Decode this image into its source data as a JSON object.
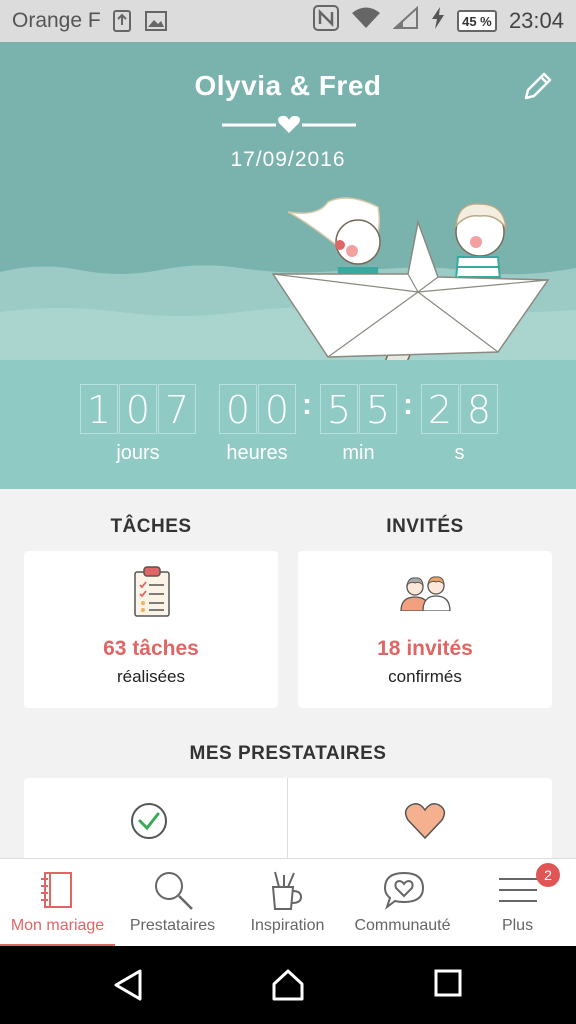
{
  "status_bar": {
    "carrier": "Orange F",
    "battery": "45 %",
    "time": "23:04"
  },
  "header": {
    "couple": "Olyvia & Fred",
    "date": "17/09/2016",
    "colors": {
      "background": "#7ab3ad",
      "countdown": "#8fcac4"
    }
  },
  "countdown": {
    "days": [
      "1",
      "0",
      "7"
    ],
    "hours": [
      "0",
      "0"
    ],
    "minutes": [
      "5",
      "5"
    ],
    "seconds": [
      "2",
      "8"
    ],
    "labels": {
      "days": "jours",
      "hours": "heures",
      "minutes": "min",
      "seconds": "s"
    },
    "separator": ":"
  },
  "tasks": {
    "title": "TÂCHES",
    "count": "63 tâches",
    "status": "réalisées"
  },
  "guests": {
    "title": "INVITÉS",
    "count": "18 invités",
    "status": "confirmés"
  },
  "vendors": {
    "title": "MES PRESTATAIRES"
  },
  "nav": {
    "items": [
      {
        "label": "Mon mariage",
        "icon": "notebook-icon",
        "active": true
      },
      {
        "label": "Prestataires",
        "icon": "search-icon"
      },
      {
        "label": "Inspiration",
        "icon": "pencil-cup-icon"
      },
      {
        "label": "Communauté",
        "icon": "chat-heart-icon"
      },
      {
        "label": "Plus",
        "icon": "menu-icon",
        "badge": "2"
      }
    ]
  },
  "accent_color": "#e06666"
}
